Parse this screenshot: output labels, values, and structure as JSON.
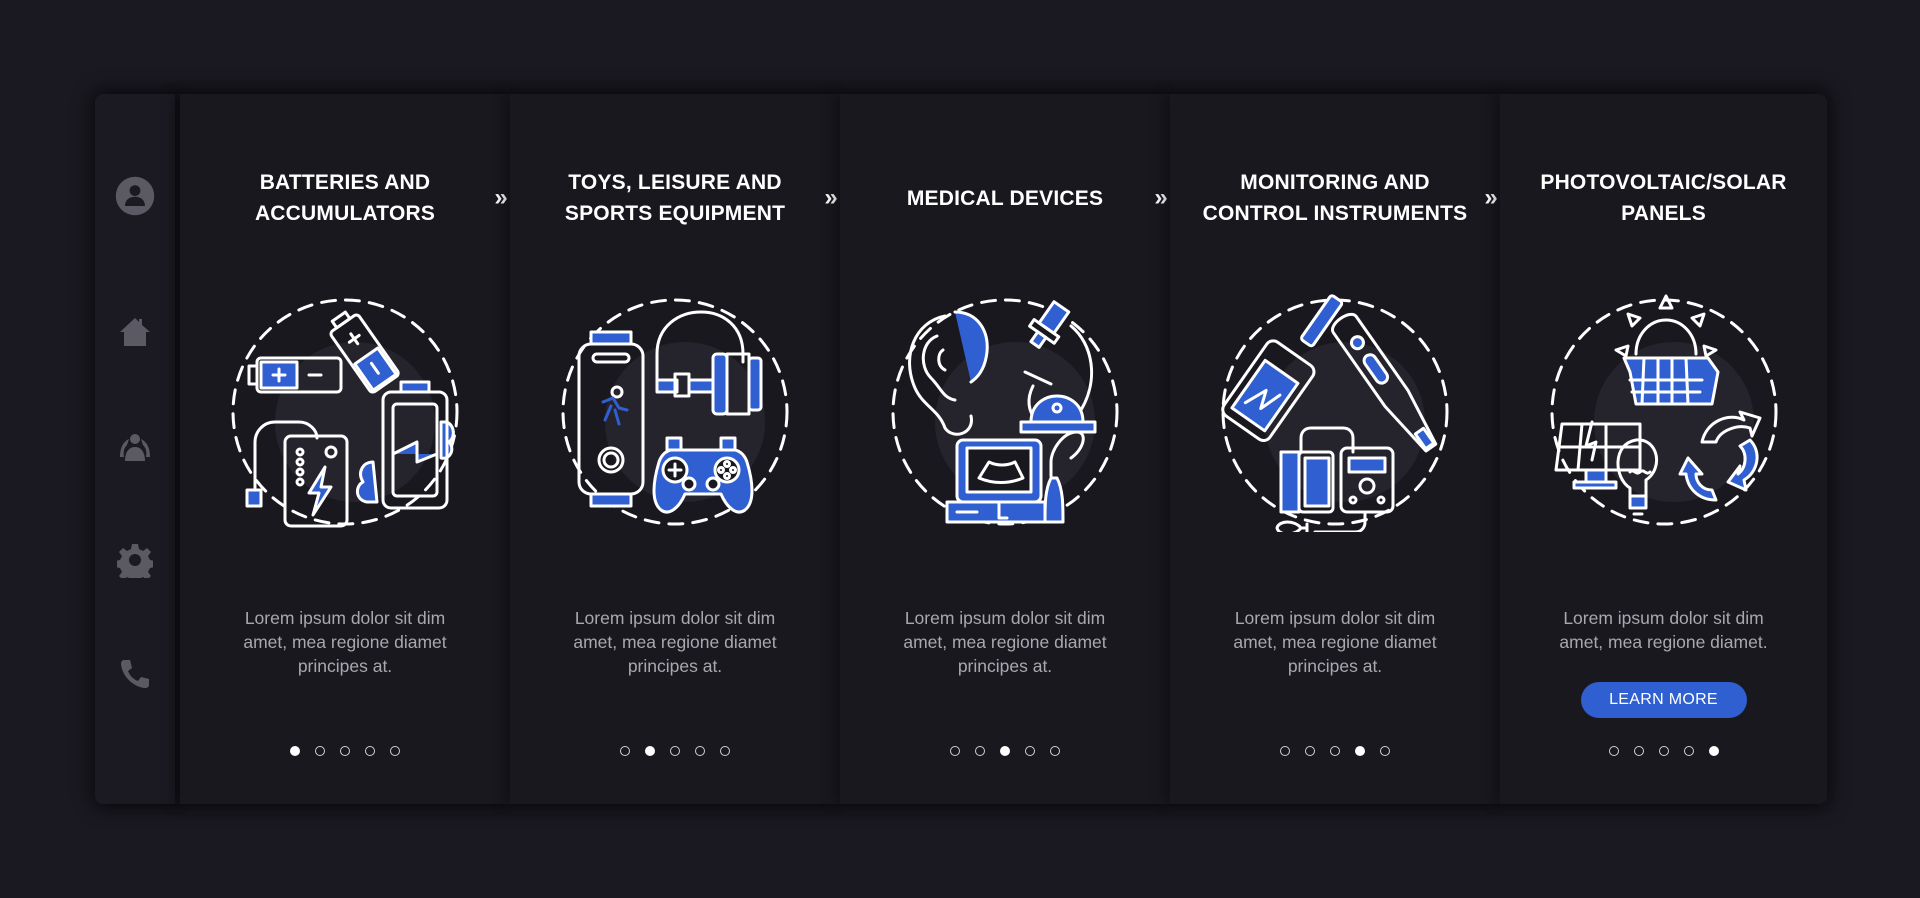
{
  "colors": {
    "background": "#1a1921",
    "panel": "#19181f",
    "accent": "#2f5fd0",
    "text_primary": "#ffffff",
    "text_secondary": "#a9a8ae",
    "icon_muted": "#5b5a64"
  },
  "sidebar": {
    "items": [
      {
        "icon": "user-profile-icon"
      },
      {
        "icon": "home-icon"
      },
      {
        "icon": "team-icon"
      },
      {
        "icon": "gear-icon"
      },
      {
        "icon": "phone-icon"
      }
    ]
  },
  "next_glyph": "»",
  "panels": [
    {
      "title_lines": [
        "Batteries and",
        "accumulators"
      ],
      "illustration": "batteries-icon",
      "description_lines": [
        "Lorem ipsum dolor sit dim",
        "amet, mea regione diamet",
        "principes at."
      ],
      "active_page": 1,
      "page_count": 5
    },
    {
      "title_lines": [
        "Toys, leisure and",
        "sports equipment"
      ],
      "illustration": "toys-sports-icon",
      "description_lines": [
        "Lorem ipsum dolor sit dim",
        "amet, mea regione diamet",
        "principes at."
      ],
      "active_page": 2,
      "page_count": 5
    },
    {
      "title_lines": [
        "Medical devices"
      ],
      "illustration": "medical-devices-icon",
      "description_lines": [
        "Lorem ipsum dolor sit dim",
        "amet, mea regione diamet",
        "principes at."
      ],
      "active_page": 3,
      "page_count": 5
    },
    {
      "title_lines": [
        "Monitoring and",
        "control instruments"
      ],
      "illustration": "monitoring-instruments-icon",
      "description_lines": [
        "Lorem ipsum dolor sit dim",
        "amet, mea regione diamet",
        "principes at."
      ],
      "active_page": 4,
      "page_count": 5
    },
    {
      "title_lines": [
        "Photovoltaic/solar",
        "panels"
      ],
      "illustration": "solar-panels-icon",
      "description_lines": [
        "Lorem ipsum dolor sit dim",
        "amet, mea regione diamet."
      ],
      "active_page": 5,
      "page_count": 5,
      "button_label": "LEARN MORE"
    }
  ]
}
